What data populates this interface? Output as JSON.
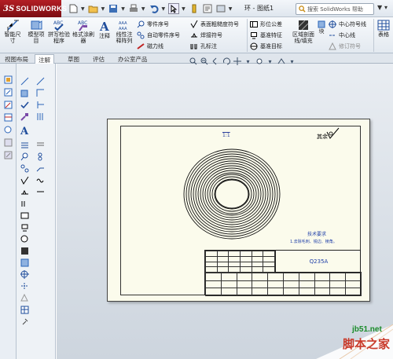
{
  "app": {
    "logo_prefix": "3S",
    "logo_text": "SOLIDWORKS",
    "doc_title": "环 - 图纸1"
  },
  "search": {
    "placeholder": "搜索 SolidWorks 帮助"
  },
  "ribbon": {
    "smart_dim": "智能尺寸",
    "model_items": "模型项目",
    "spell_check": "拼写检验程序",
    "format_painter": "格式涂刷器",
    "note": "注释",
    "linear_pattern": "线性注释阵列",
    "balloon": "零件序号",
    "auto_balloon": "自动零件序号",
    "magnetic_line": "磁力线",
    "surface_finish": "表面粗糙度符号",
    "weld_symbol": "焊接符号",
    "hole_callout": "孔标注",
    "geometric_tol": "形位公差",
    "datum_feature": "基准特征",
    "datum_target": "基准目标",
    "area_hatch": "区域剖面线/填充",
    "block": "块",
    "centermark": "中心符号线",
    "centerline": "中心线",
    "revision_symbol": "修订符号",
    "table": "表格"
  },
  "tabs": [
    {
      "label": "视图布局"
    },
    {
      "label": "注解"
    },
    {
      "label": "草图"
    },
    {
      "label": "评估"
    },
    {
      "label": "办公室产品"
    }
  ],
  "drawing": {
    "top_mark": "1:1",
    "surface_note": "其余",
    "tech_title": "技术要求",
    "tech_text": "1.去除毛刺、锐边、棱角。",
    "material": "Q235A"
  },
  "watermark": {
    "site": "jb51.net",
    "name": "脚本之家"
  }
}
